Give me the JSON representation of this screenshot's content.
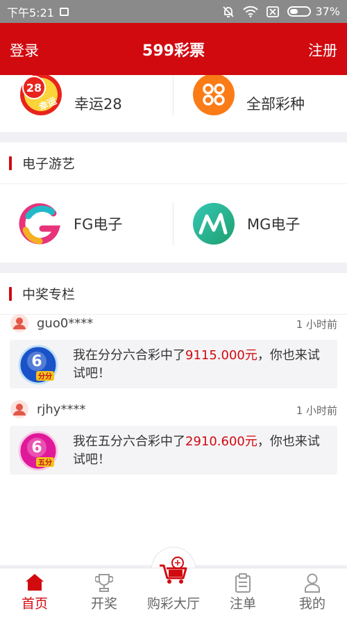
{
  "status_bar": {
    "time": "下午5:21",
    "battery": "37%"
  },
  "header": {
    "login": "登录",
    "title": "599彩票",
    "register": "注册"
  },
  "lotteries": [
    {
      "label": "幸运28",
      "icon_text": "28",
      "icon_sub": "幸运"
    },
    {
      "label": "全部彩种"
    }
  ],
  "games_section": {
    "title": "电子游艺",
    "items": [
      {
        "label": "FG电子"
      },
      {
        "label": "MG电子"
      }
    ]
  },
  "winners_section": {
    "title": "中奖专栏",
    "entries": [
      {
        "user": "guo0****",
        "time": "1 小时前",
        "msg_pre": "我在分分六合彩中了",
        "amount": "9115.000元",
        "msg_post": "，你也来试试吧！",
        "icon_num": "6",
        "icon_label": "分分",
        "icon_color": "#1a52c8"
      },
      {
        "user": "rjhy****",
        "time": "1 小时前",
        "msg_pre": "我在五分六合彩中了",
        "amount": "2910.600元",
        "msg_post": "，你也来试试吧！",
        "icon_num": "6",
        "icon_label": "五分",
        "icon_color": "#e0199a"
      }
    ]
  },
  "tabbar": {
    "items": [
      {
        "label": "首页",
        "icon": "home-icon",
        "active": true
      },
      {
        "label": "开奖",
        "icon": "trophy-icon"
      },
      {
        "label": "购彩大厅",
        "icon": "cart-icon"
      },
      {
        "label": "注单",
        "icon": "clipboard-icon"
      },
      {
        "label": "我的",
        "icon": "user-icon"
      }
    ]
  },
  "colors": {
    "brand_red": "#d10a10",
    "statusbar": "#8a8a8a"
  }
}
